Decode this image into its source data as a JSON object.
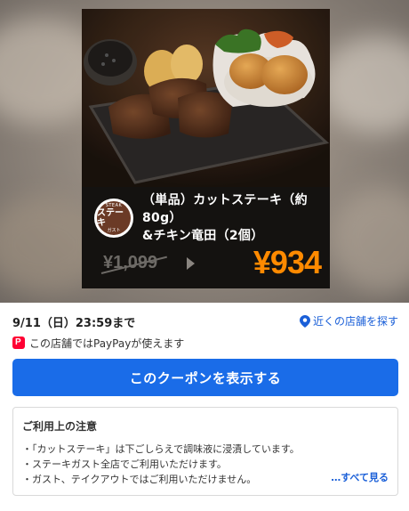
{
  "coupon": {
    "product_name": "（単品）カットステーキ（約80g）\n&チキン竜田（2個）",
    "logo": {
      "top": "STEAK",
      "middle": "ステーキ",
      "bottom": "ガスト"
    },
    "old_price": "¥1,099",
    "new_price": "¥934"
  },
  "deadline": "9/11（日）23:59まで",
  "nearby_link": "近くの店舗を探す",
  "paypay_text": "この店舗ではPayPayが使えます",
  "show_button": "このクーポンを表示する",
  "notice": {
    "title": "ご利用上の注意",
    "items": [
      "・「カットステーキ」は下ごしらえで調味液に浸漬しています。",
      "・ステーキガスト全店でご利用いただけます。",
      "・ガスト、テイクアウトではご利用いただけません。"
    ],
    "see_all": "…すべて見る"
  },
  "colors": {
    "primary": "#1a6ce8",
    "link": "#1a5fd8",
    "price": "#ff8a00",
    "paypay": "#ff0033"
  }
}
